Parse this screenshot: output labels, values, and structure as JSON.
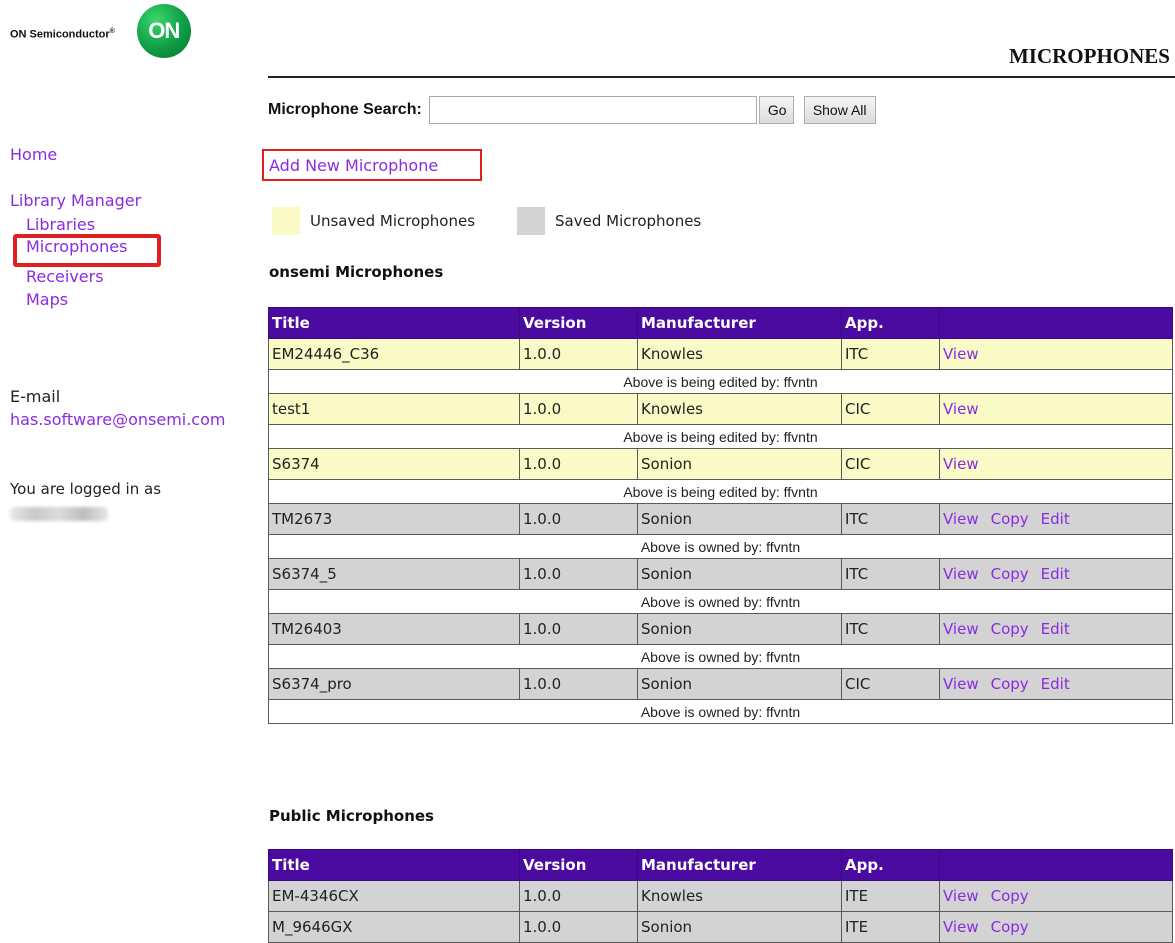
{
  "brand": {
    "company": "ON Semiconductor",
    "reg": "®",
    "logo_text": "ON"
  },
  "header": {
    "title": "MICROPHONES"
  },
  "search": {
    "label": "Microphone Search:",
    "value": "",
    "go_label": "Go",
    "show_all_label": "Show All"
  },
  "add_link": "Add New Microphone",
  "legend": {
    "unsaved": "Unsaved Microphones",
    "saved": "Saved Microphones",
    "unsaved_color": "#fafac6",
    "saved_color": "#d3d3d3"
  },
  "sidebar": {
    "home": "Home",
    "library_manager": "Library Manager",
    "libraries": "Libraries",
    "microphones": "Microphones",
    "receivers": "Receivers",
    "maps": "Maps",
    "email_label": "E-mail",
    "email": "has.software@onsemi.com",
    "logged_in": "You are logged in as"
  },
  "columns": {
    "title": "Title",
    "version": "Version",
    "manufacturer": "Manufacturer",
    "app": "App."
  },
  "onsemi": {
    "heading": "onsemi Microphones",
    "rows": [
      {
        "title": "EM24446_C36",
        "version": "1.0.0",
        "manufacturer": "Knowles",
        "app": "ITC",
        "view": "View",
        "note": "Above is being edited by: ffvntn"
      },
      {
        "title": "test1",
        "version": "1.0.0",
        "manufacturer": "Knowles",
        "app": "CIC",
        "view": "View",
        "note": "Above is being edited by: ffvntn"
      },
      {
        "title": "S6374",
        "version": "1.0.0",
        "manufacturer": "Sonion",
        "app": "CIC",
        "view": "View",
        "note": "Above is being edited by: ffvntn"
      },
      {
        "title": "TM2673",
        "version": "1.0.0",
        "manufacturer": "Sonion",
        "app": "ITC",
        "view": "View",
        "copy": "Copy",
        "edit": "Edit",
        "note": "Above is owned by: ffvntn"
      },
      {
        "title": "S6374_5",
        "version": "1.0.0",
        "manufacturer": "Sonion",
        "app": "ITC",
        "view": "View",
        "copy": "Copy",
        "edit": "Edit",
        "note": "Above is owned by: ffvntn"
      },
      {
        "title": "TM26403",
        "version": "1.0.0",
        "manufacturer": "Sonion",
        "app": "ITC",
        "view": "View",
        "copy": "Copy",
        "edit": "Edit",
        "note": "Above is owned by: ffvntn"
      },
      {
        "title": "S6374_pro",
        "version": "1.0.0",
        "manufacturer": "Sonion",
        "app": "CIC",
        "view": "View",
        "copy": "Copy",
        "edit": "Edit",
        "note": "Above is owned by: ffvntn"
      }
    ]
  },
  "public": {
    "heading": "Public Microphones",
    "rows": [
      {
        "title": "EM-4346CX",
        "version": "1.0.0",
        "manufacturer": "Knowles",
        "app": "ITE",
        "view": "View",
        "copy": "Copy"
      },
      {
        "title": "M_9646GX",
        "version": "1.0.0",
        "manufacturer": "Sonion",
        "app": "ITE",
        "view": "View",
        "copy": "Copy"
      }
    ]
  }
}
